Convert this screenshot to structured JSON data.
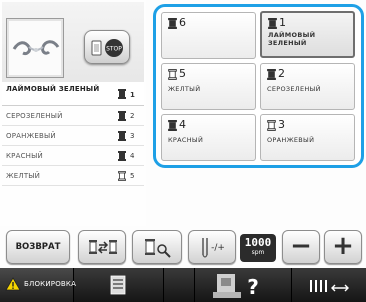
{
  "left_panel": {
    "embroidery_thumb": "embroidery-preview-image",
    "stop_icon": "stop-icon",
    "colors": [
      {
        "name": "ЛАЙМОВЫЙ ЗЕЛЕНЫЙ",
        "num": "1",
        "spool": "light"
      },
      {
        "name": "СЕРОЗЕЛЕНЫЙ",
        "num": "2",
        "spool": "dark"
      },
      {
        "name": "ОРАНЖЕВЫЙ",
        "num": "3",
        "spool": "dark"
      },
      {
        "name": "КРАСНЫЙ",
        "num": "4",
        "spool": "dark"
      },
      {
        "name": "ЖЕЛТЫЙ",
        "num": "5",
        "spool": "outline"
      }
    ]
  },
  "grid": {
    "accent": "#1ea0e6",
    "tiles": [
      {
        "num": "6",
        "name": "",
        "spool": "dark"
      },
      {
        "num": "1",
        "name": "ЛАЙМОВЫЙ ЗЕЛЕНЫЙ",
        "spool": "dark",
        "selected": true
      },
      {
        "num": "5",
        "name": "ЖЕЛТЫЙ",
        "spool": "outline"
      },
      {
        "num": "2",
        "name": "СЕРОЗЕЛЕНЫЙ",
        "spool": "dark"
      },
      {
        "num": "4",
        "name": "КРАСНЫЙ",
        "spool": "dark"
      },
      {
        "num": "3",
        "name": "ОРАНЖЕВЫЙ",
        "spool": "outline"
      }
    ]
  },
  "toolbar": {
    "back_label": "ВОЗВРАТ",
    "speed_value": "1000",
    "speed_unit": "spm",
    "minus": "−",
    "plus": "+"
  },
  "status_bar": {
    "lock_label": "БЛОКИРОВКА"
  }
}
